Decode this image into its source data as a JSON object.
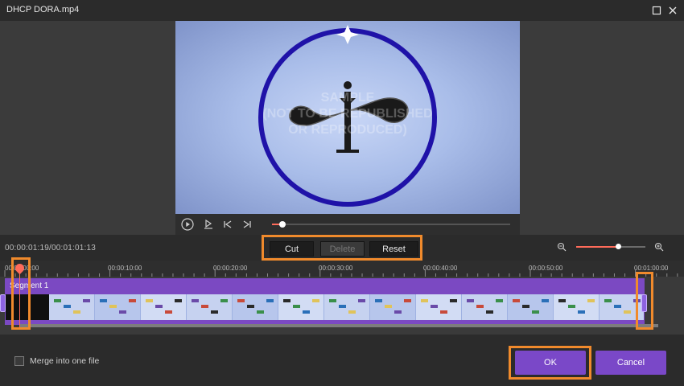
{
  "window": {
    "title": "DHCP DORA.mp4",
    "maximize_icon": "maximize-icon",
    "close_icon": "close-icon"
  },
  "preview": {
    "watermark_lines": [
      "SAMPLE",
      "(NOT TO BE REPUBLISHED",
      "OR REPRODUCED)"
    ],
    "playback_progress": 0.03
  },
  "edit": {
    "time_readout": "00:00:01:19/00:01:01:13",
    "cut_label": "Cut",
    "delete_label": "Delete",
    "reset_label": "Reset",
    "zoom_level": 0.6
  },
  "timeline": {
    "ticks": [
      "00:00:00:00",
      "00:00:10:00",
      "00:00:20:00",
      "00:00:30:00",
      "00:00:40:00",
      "00:00:50:00",
      "00:01:00:00"
    ],
    "segment_label": "Segment 1"
  },
  "footer": {
    "merge_label": "Merge into one file",
    "merge_checked": false,
    "ok_label": "OK",
    "cancel_label": "Cancel"
  },
  "colors": {
    "accent": "#7a48c8",
    "highlight": "#f08a2c",
    "playhead": "#ff6b5a"
  }
}
